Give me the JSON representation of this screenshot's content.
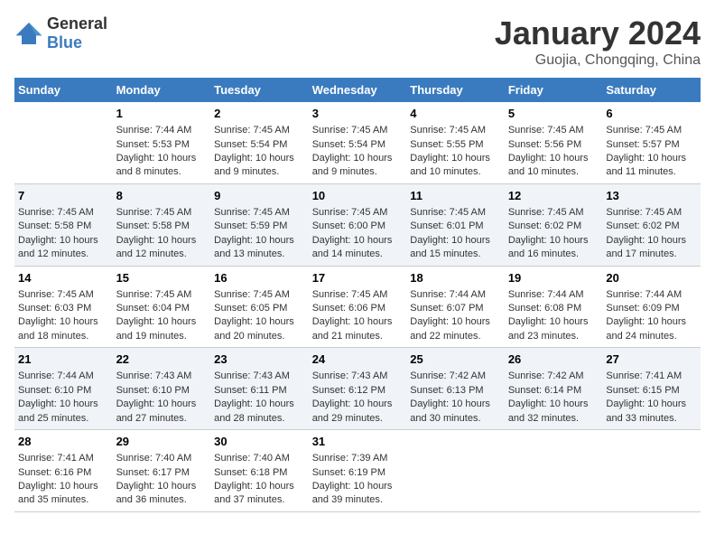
{
  "logo": {
    "general": "General",
    "blue": "Blue"
  },
  "title": "January 2024",
  "subtitle": "Guojia, Chongqing, China",
  "columns": [
    "Sunday",
    "Monday",
    "Tuesday",
    "Wednesday",
    "Thursday",
    "Friday",
    "Saturday"
  ],
  "rows": [
    [
      {
        "day": "",
        "sunrise": "",
        "sunset": "",
        "daylight": ""
      },
      {
        "day": "1",
        "sunrise": "Sunrise: 7:44 AM",
        "sunset": "Sunset: 5:53 PM",
        "daylight": "Daylight: 10 hours and 8 minutes."
      },
      {
        "day": "2",
        "sunrise": "Sunrise: 7:45 AM",
        "sunset": "Sunset: 5:54 PM",
        "daylight": "Daylight: 10 hours and 9 minutes."
      },
      {
        "day": "3",
        "sunrise": "Sunrise: 7:45 AM",
        "sunset": "Sunset: 5:54 PM",
        "daylight": "Daylight: 10 hours and 9 minutes."
      },
      {
        "day": "4",
        "sunrise": "Sunrise: 7:45 AM",
        "sunset": "Sunset: 5:55 PM",
        "daylight": "Daylight: 10 hours and 10 minutes."
      },
      {
        "day": "5",
        "sunrise": "Sunrise: 7:45 AM",
        "sunset": "Sunset: 5:56 PM",
        "daylight": "Daylight: 10 hours and 10 minutes."
      },
      {
        "day": "6",
        "sunrise": "Sunrise: 7:45 AM",
        "sunset": "Sunset: 5:57 PM",
        "daylight": "Daylight: 10 hours and 11 minutes."
      }
    ],
    [
      {
        "day": "7",
        "sunrise": "Sunrise: 7:45 AM",
        "sunset": "Sunset: 5:58 PM",
        "daylight": "Daylight: 10 hours and 12 minutes."
      },
      {
        "day": "8",
        "sunrise": "Sunrise: 7:45 AM",
        "sunset": "Sunset: 5:58 PM",
        "daylight": "Daylight: 10 hours and 12 minutes."
      },
      {
        "day": "9",
        "sunrise": "Sunrise: 7:45 AM",
        "sunset": "Sunset: 5:59 PM",
        "daylight": "Daylight: 10 hours and 13 minutes."
      },
      {
        "day": "10",
        "sunrise": "Sunrise: 7:45 AM",
        "sunset": "Sunset: 6:00 PM",
        "daylight": "Daylight: 10 hours and 14 minutes."
      },
      {
        "day": "11",
        "sunrise": "Sunrise: 7:45 AM",
        "sunset": "Sunset: 6:01 PM",
        "daylight": "Daylight: 10 hours and 15 minutes."
      },
      {
        "day": "12",
        "sunrise": "Sunrise: 7:45 AM",
        "sunset": "Sunset: 6:02 PM",
        "daylight": "Daylight: 10 hours and 16 minutes."
      },
      {
        "day": "13",
        "sunrise": "Sunrise: 7:45 AM",
        "sunset": "Sunset: 6:02 PM",
        "daylight": "Daylight: 10 hours and 17 minutes."
      }
    ],
    [
      {
        "day": "14",
        "sunrise": "Sunrise: 7:45 AM",
        "sunset": "Sunset: 6:03 PM",
        "daylight": "Daylight: 10 hours and 18 minutes."
      },
      {
        "day": "15",
        "sunrise": "Sunrise: 7:45 AM",
        "sunset": "Sunset: 6:04 PM",
        "daylight": "Daylight: 10 hours and 19 minutes."
      },
      {
        "day": "16",
        "sunrise": "Sunrise: 7:45 AM",
        "sunset": "Sunset: 6:05 PM",
        "daylight": "Daylight: 10 hours and 20 minutes."
      },
      {
        "day": "17",
        "sunrise": "Sunrise: 7:45 AM",
        "sunset": "Sunset: 6:06 PM",
        "daylight": "Daylight: 10 hours and 21 minutes."
      },
      {
        "day": "18",
        "sunrise": "Sunrise: 7:44 AM",
        "sunset": "Sunset: 6:07 PM",
        "daylight": "Daylight: 10 hours and 22 minutes."
      },
      {
        "day": "19",
        "sunrise": "Sunrise: 7:44 AM",
        "sunset": "Sunset: 6:08 PM",
        "daylight": "Daylight: 10 hours and 23 minutes."
      },
      {
        "day": "20",
        "sunrise": "Sunrise: 7:44 AM",
        "sunset": "Sunset: 6:09 PM",
        "daylight": "Daylight: 10 hours and 24 minutes."
      }
    ],
    [
      {
        "day": "21",
        "sunrise": "Sunrise: 7:44 AM",
        "sunset": "Sunset: 6:10 PM",
        "daylight": "Daylight: 10 hours and 25 minutes."
      },
      {
        "day": "22",
        "sunrise": "Sunrise: 7:43 AM",
        "sunset": "Sunset: 6:10 PM",
        "daylight": "Daylight: 10 hours and 27 minutes."
      },
      {
        "day": "23",
        "sunrise": "Sunrise: 7:43 AM",
        "sunset": "Sunset: 6:11 PM",
        "daylight": "Daylight: 10 hours and 28 minutes."
      },
      {
        "day": "24",
        "sunrise": "Sunrise: 7:43 AM",
        "sunset": "Sunset: 6:12 PM",
        "daylight": "Daylight: 10 hours and 29 minutes."
      },
      {
        "day": "25",
        "sunrise": "Sunrise: 7:42 AM",
        "sunset": "Sunset: 6:13 PM",
        "daylight": "Daylight: 10 hours and 30 minutes."
      },
      {
        "day": "26",
        "sunrise": "Sunrise: 7:42 AM",
        "sunset": "Sunset: 6:14 PM",
        "daylight": "Daylight: 10 hours and 32 minutes."
      },
      {
        "day": "27",
        "sunrise": "Sunrise: 7:41 AM",
        "sunset": "Sunset: 6:15 PM",
        "daylight": "Daylight: 10 hours and 33 minutes."
      }
    ],
    [
      {
        "day": "28",
        "sunrise": "Sunrise: 7:41 AM",
        "sunset": "Sunset: 6:16 PM",
        "daylight": "Daylight: 10 hours and 35 minutes."
      },
      {
        "day": "29",
        "sunrise": "Sunrise: 7:40 AM",
        "sunset": "Sunset: 6:17 PM",
        "daylight": "Daylight: 10 hours and 36 minutes."
      },
      {
        "day": "30",
        "sunrise": "Sunrise: 7:40 AM",
        "sunset": "Sunset: 6:18 PM",
        "daylight": "Daylight: 10 hours and 37 minutes."
      },
      {
        "day": "31",
        "sunrise": "Sunrise: 7:39 AM",
        "sunset": "Sunset: 6:19 PM",
        "daylight": "Daylight: 10 hours and 39 minutes."
      },
      {
        "day": "",
        "sunrise": "",
        "sunset": "",
        "daylight": ""
      },
      {
        "day": "",
        "sunrise": "",
        "sunset": "",
        "daylight": ""
      },
      {
        "day": "",
        "sunrise": "",
        "sunset": "",
        "daylight": ""
      }
    ]
  ]
}
